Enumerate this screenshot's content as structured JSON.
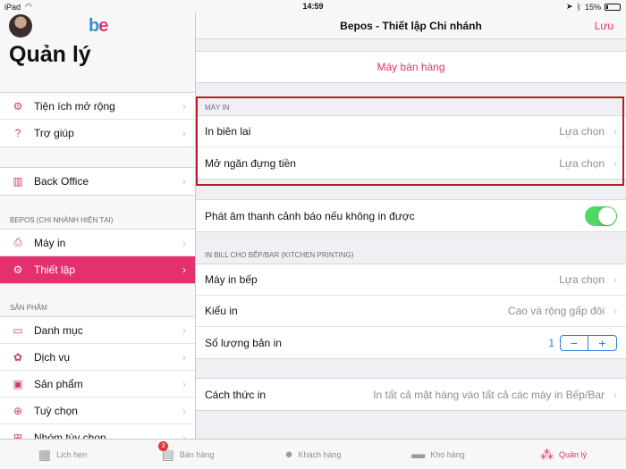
{
  "status_bar": {
    "device": "iPad",
    "time": "14:59",
    "battery": "15%"
  },
  "sidebar": {
    "title": "Quản lý",
    "logo_b": "b",
    "logo_e": "e",
    "group1": [
      {
        "label": "Tiện ích mở rộng",
        "icon": "gear-icon"
      },
      {
        "label": "Trợ giúp",
        "icon": "help-icon"
      }
    ],
    "back_office": {
      "label": "Back Office",
      "icon": "chart-icon"
    },
    "section_branch": "BEPOS (CHI NHÁNH HIỆN TẠI)",
    "group_branch": [
      {
        "label": "Máy in",
        "icon": "printer-icon"
      },
      {
        "label": "Thiết lập",
        "icon": "settings-icon"
      }
    ],
    "section_products": "SẢN PHẨM",
    "group_products": [
      {
        "label": "Danh mục",
        "icon": "category-icon"
      },
      {
        "label": "Dịch vụ",
        "icon": "service-icon"
      },
      {
        "label": "Sản phẩm",
        "icon": "product-icon"
      },
      {
        "label": "Tuỳ chọn",
        "icon": "option-icon"
      },
      {
        "label": "Nhóm tùy chọn",
        "icon": "option-group-icon"
      }
    ]
  },
  "nav": {
    "title": "Bepos - Thiết lập Chi nhánh",
    "save": "Lưu"
  },
  "main": {
    "sales_machine": "Máy bán hàng",
    "printer_header": "MÁY IN",
    "printer_rows": [
      {
        "label": "In biên lai",
        "value": "Lựa chọn"
      },
      {
        "label": "Mở ngăn đựng tiền",
        "value": "Lựa chọn"
      }
    ],
    "sound_alert": "Phát âm thanh cảnh báo nếu không in được",
    "sound_alert_on": true,
    "kitchen_header": "IN BILL CHO BẾP/BAR (KITCHEN PRINTING)",
    "kitchen_rows": [
      {
        "label": "Máy in bếp",
        "value": "Lựa chọn"
      },
      {
        "label": "Kiểu in",
        "value": "Cao và rộng gấp đôi"
      }
    ],
    "copies_label": "Số lượng bản in",
    "copies_value": "1",
    "stepper_minus": "−",
    "stepper_plus": "+",
    "print_method_label": "Cách thức in",
    "print_method_value": "In tất cả mặt hàng vào tất cả các máy in Bếp/Bar"
  },
  "tabbar": {
    "tabs": [
      {
        "label": "Lịch hẹn",
        "icon": "calendar-icon"
      },
      {
        "label": "Bán hàng",
        "icon": "cart-icon",
        "badge": "3"
      },
      {
        "label": "Khách hàng",
        "icon": "person-icon"
      },
      {
        "label": "Kho hàng",
        "icon": "box-icon"
      },
      {
        "label": "Quản lý",
        "icon": "manage-icon"
      }
    ],
    "active": "Quản lý"
  },
  "colors": {
    "accent": "#e5306f",
    "toggle_on": "#4cd964",
    "link_blue": "#2e7be0",
    "highlight_border": "#b3202c"
  }
}
